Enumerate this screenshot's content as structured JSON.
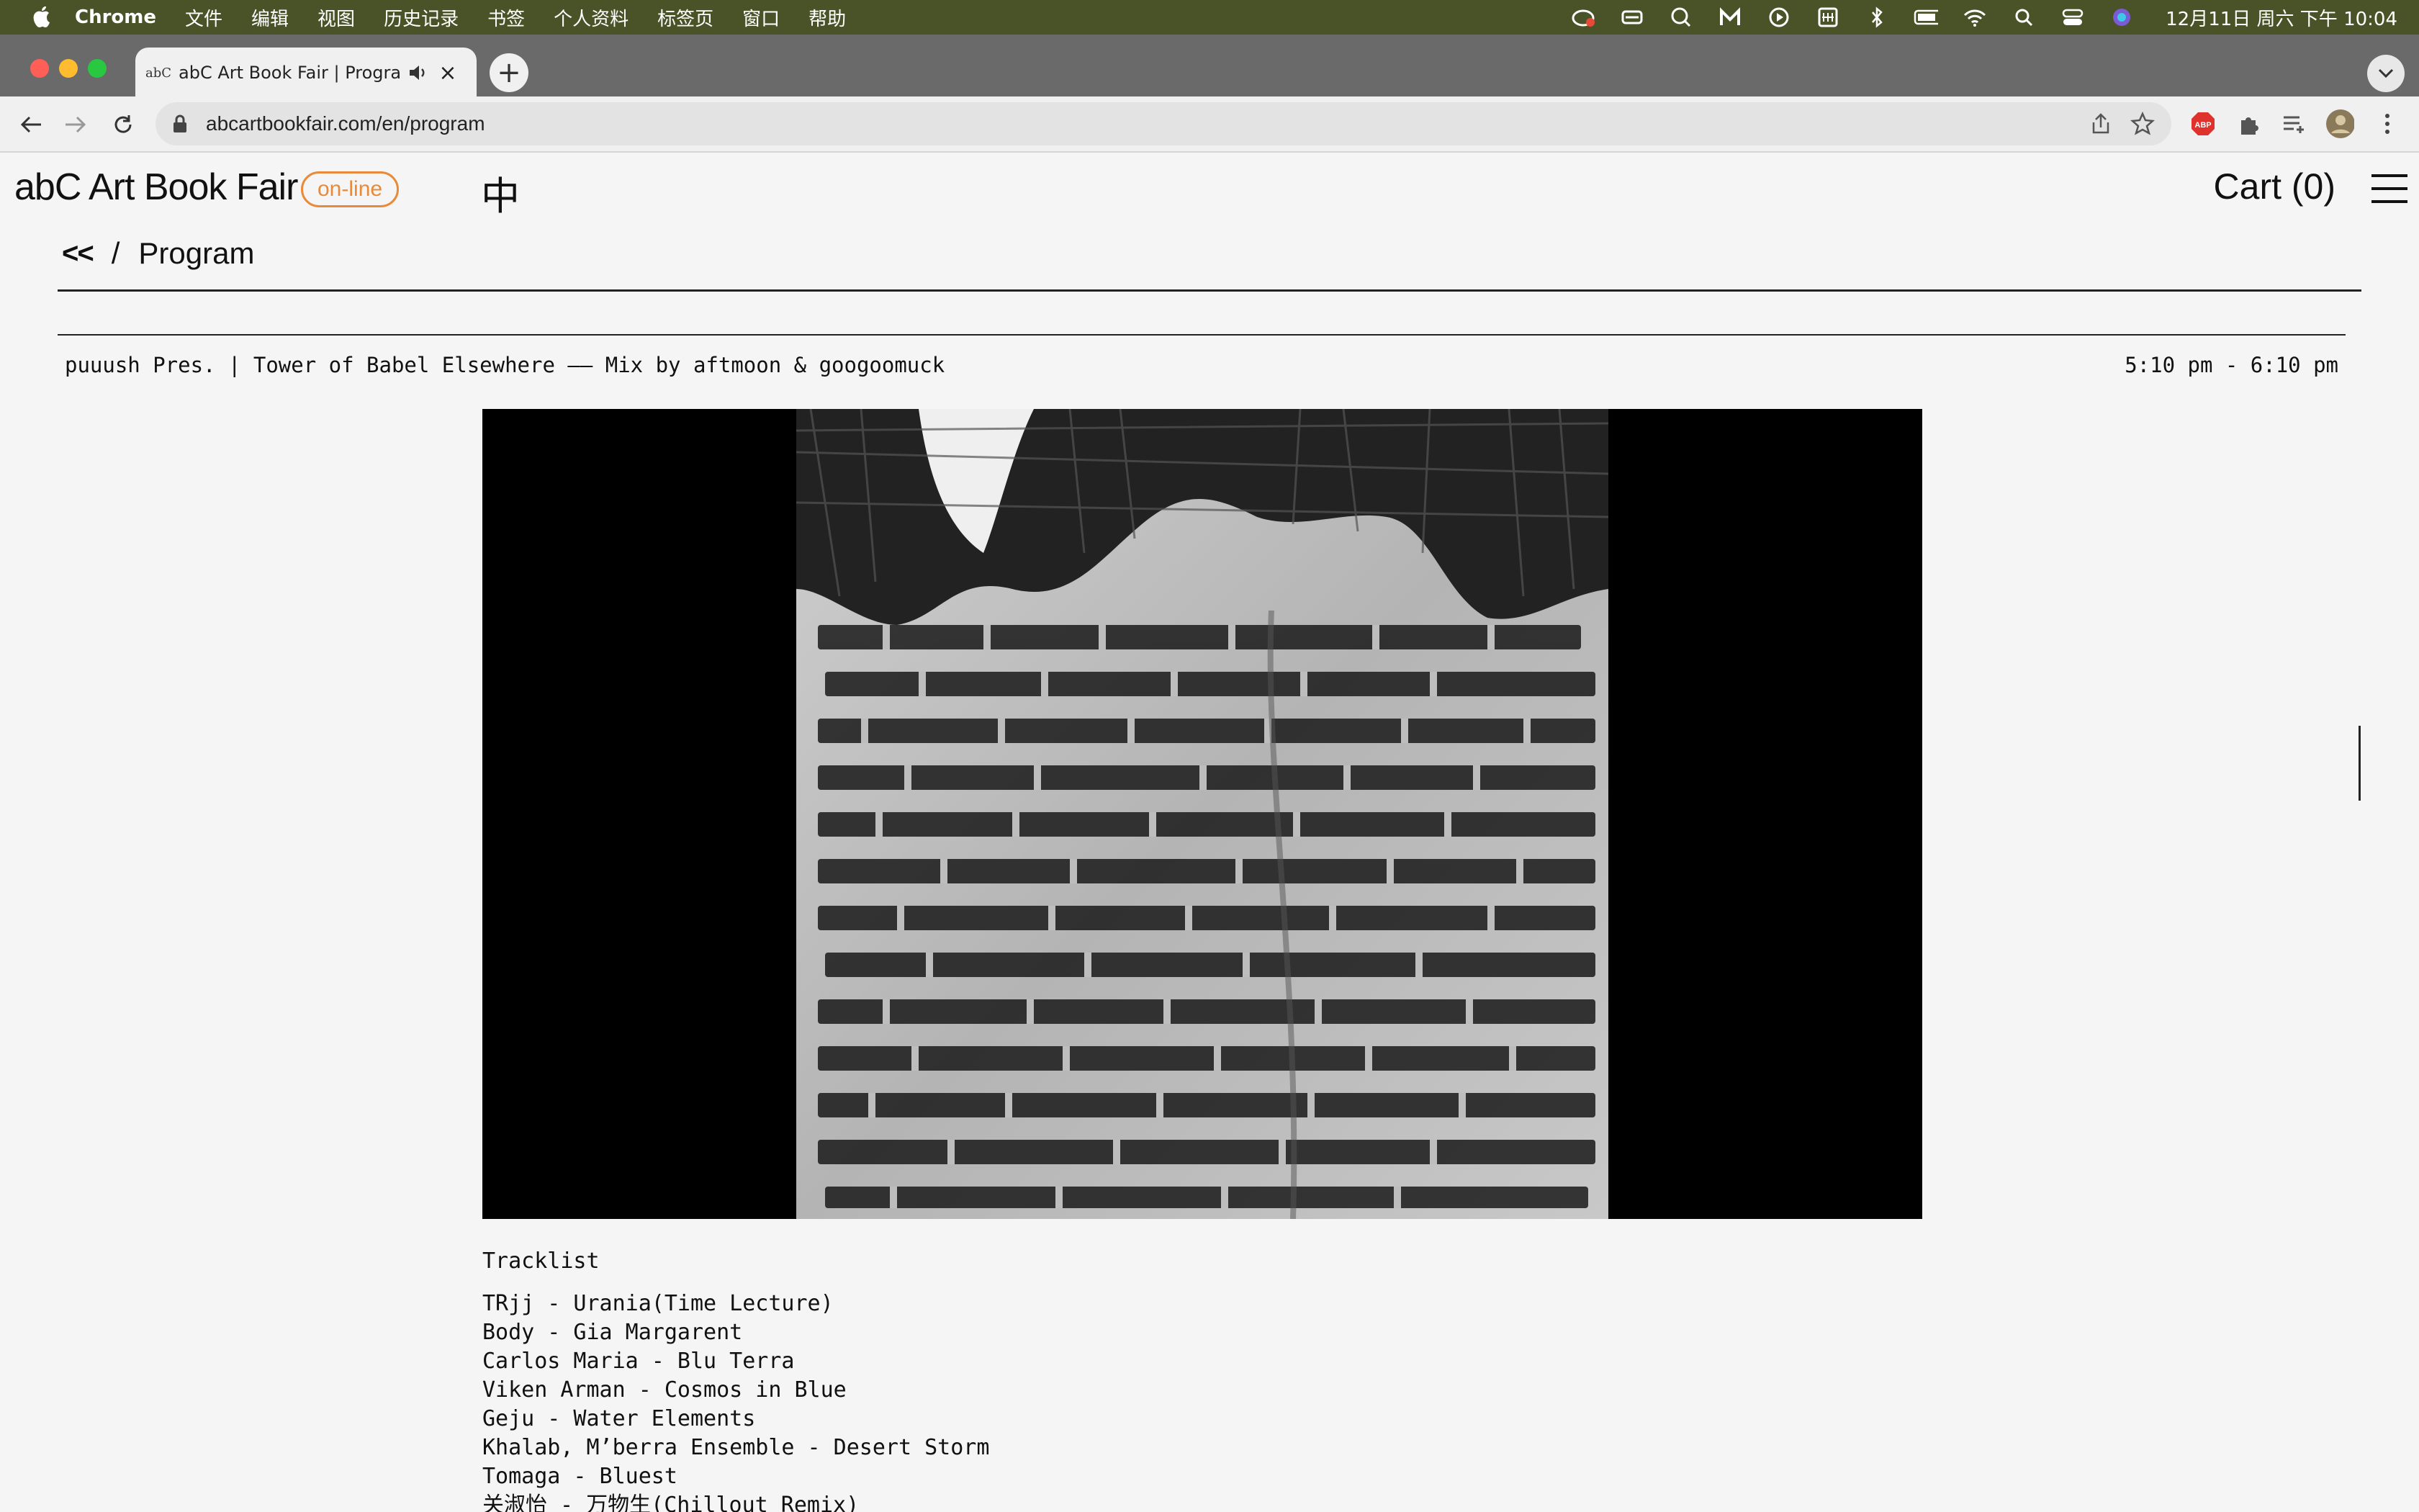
{
  "menubar": {
    "app": "Chrome",
    "items": [
      "文件",
      "编辑",
      "视图",
      "历史记录",
      "书签",
      "个人资料",
      "标签页",
      "窗口",
      "帮助"
    ],
    "clock": "12月11日 周六 下午 10:04"
  },
  "tab": {
    "title": "abC Art Book Fair | Program",
    "favicon": "abC"
  },
  "omnibox": {
    "url": "abcartbookfair.com/en/program"
  },
  "site": {
    "logo": "abC Art Book Fair",
    "badge": "on-line",
    "lang_switch": "中",
    "cart": "Cart (0)",
    "accent_color": "#e88a3a"
  },
  "breadcrumb": {
    "back": "<<",
    "separator": "/",
    "current": "Program"
  },
  "event": {
    "title": "puuush Pres. | Tower of Babel Elsewhere —— Mix by aftmoon & googoomuck",
    "time": "5:10 pm - 6:10 pm"
  },
  "tracklist": {
    "heading": "Tracklist",
    "tracks": [
      "TRjj - Urania(Time Lecture)",
      "Body - Gia Margarent",
      "Carlos Maria - Blu Terra",
      "Viken Arman - Cosmos in Blue",
      "Geju - Water Elements",
      "Khalab, M’berra Ensemble - Desert Storm",
      "Tomaga - Bluest",
      "关淑怡 - 万物生(Chillout Remix)"
    ]
  }
}
